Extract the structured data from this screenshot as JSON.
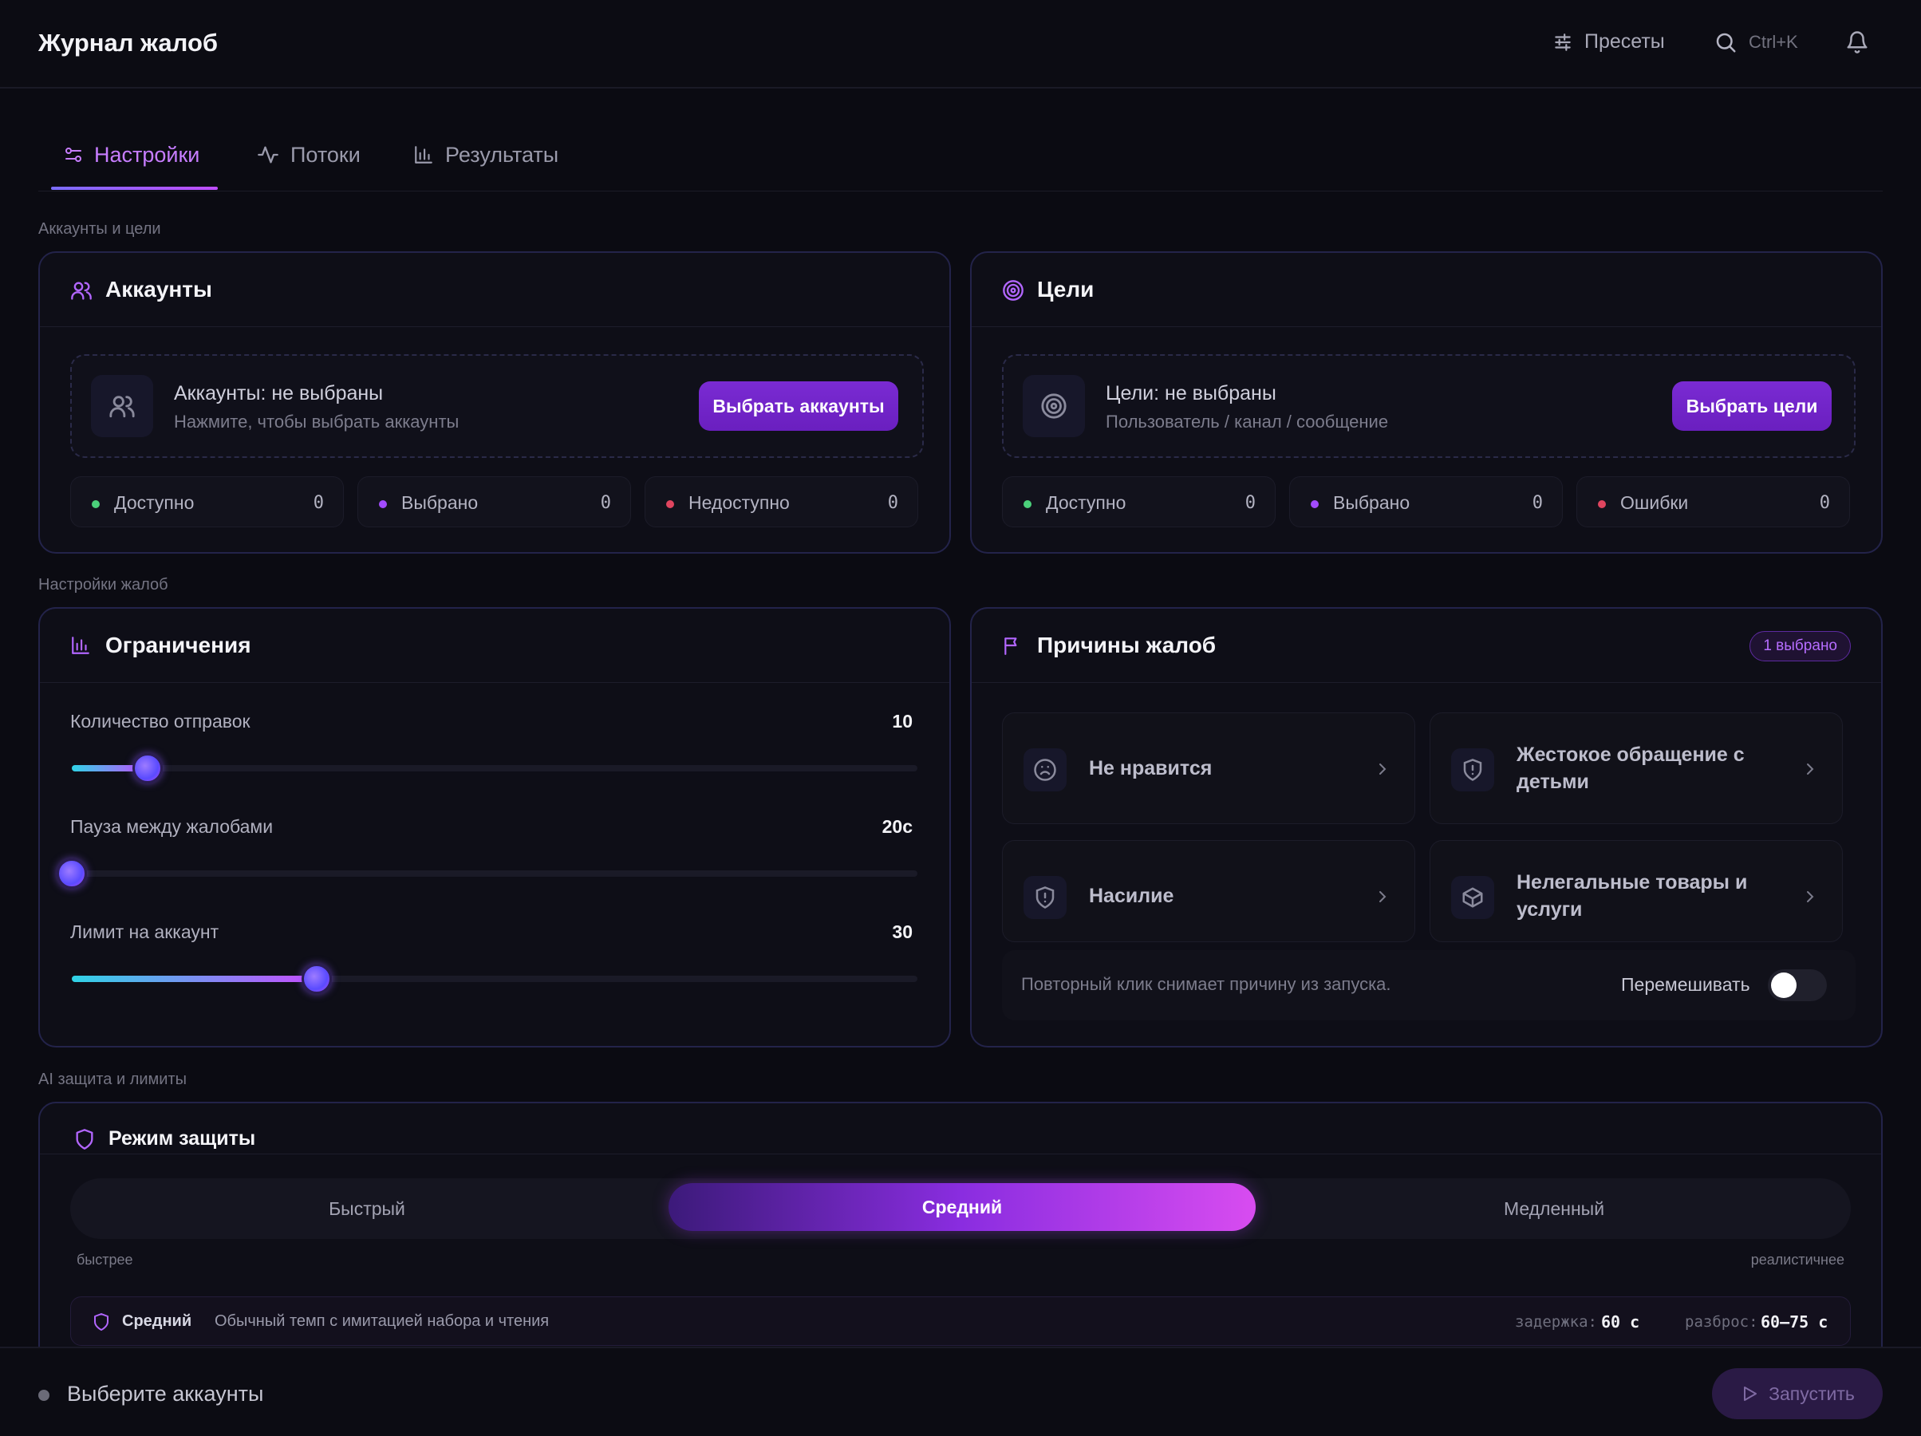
{
  "header": {
    "title": "Журнал жалоб",
    "presets_label": "Пресеты",
    "search_shortcut": "Ctrl+K"
  },
  "tabs": [
    {
      "label": "Настройки",
      "active": true,
      "icon": "sliders-icon"
    },
    {
      "label": "Потоки",
      "active": false,
      "icon": "activity-icon"
    },
    {
      "label": "Результаты",
      "active": false,
      "icon": "bar-chart-icon"
    }
  ],
  "sections": {
    "accounts_targets": "Аккаунты и цели",
    "complaint_settings": "Настройки жалоб",
    "ai_protection": "AI защита и лимиты"
  },
  "accounts": {
    "title": "Аккаунты",
    "status_title": "Аккаунты: не выбраны",
    "status_sub": "Нажмите, чтобы выбрать аккаунты",
    "button": "Выбрать аккаунты",
    "stats": [
      {
        "label": "Доступно",
        "value": "0",
        "color": "#4bd07a"
      },
      {
        "label": "Выбрано",
        "value": "0",
        "color": "#a24bff"
      },
      {
        "label": "Недоступно",
        "value": "0",
        "color": "#e0455f"
      }
    ]
  },
  "targets": {
    "title": "Цели",
    "status_title": "Цели: не выбраны",
    "status_sub": "Пользователь / канал / сообщение",
    "button": "Выбрать цели",
    "stats": [
      {
        "label": "Доступно",
        "value": "0",
        "color": "#4bd07a"
      },
      {
        "label": "Выбрано",
        "value": "0",
        "color": "#a24bff"
      },
      {
        "label": "Ошибки",
        "value": "0",
        "color": "#e0455f"
      }
    ]
  },
  "limits": {
    "title": "Ограничения",
    "sliders": [
      {
        "label": "Количество отправок",
        "value": "10",
        "fraction": 0.09
      },
      {
        "label": "Пауза между жалобами",
        "value": "20с",
        "fraction": 0.0
      },
      {
        "label": "Лимит на аккаунт",
        "value": "30",
        "fraction": 0.29
      }
    ]
  },
  "reasons": {
    "title": "Причины жалоб",
    "selected_badge": "1 выбрано",
    "items": [
      {
        "label": "Не нравится",
        "icon": "frown-icon"
      },
      {
        "label": "Жестокое обращение с детьми",
        "icon": "shield-alert-icon"
      },
      {
        "label": "Насилие",
        "icon": "shield-alert-icon"
      },
      {
        "label": "Нелегальные товары и услуги",
        "icon": "box-icon"
      }
    ],
    "footer_note": "Повторный клик снимает причину из запуска.",
    "shuffle_label": "Перемешивать",
    "shuffle_on": false
  },
  "protection": {
    "title": "Режим защиты",
    "modes": [
      "Быстрый",
      "Средний",
      "Медленный"
    ],
    "active_mode": "Средний",
    "hint_left": "быстрее",
    "hint_right": "реалистичнее",
    "info_name": "Средний",
    "info_desc": "Обычный темп с имитацией набора и чтения",
    "delay_label": "задержка:",
    "delay_value": "60 с",
    "spread_label": "разброс:",
    "spread_value": "60–75 с"
  },
  "footer": {
    "status": "Выберите аккаунты",
    "run_button": "Запустить"
  },
  "colors": {
    "accent": "#8a2de0",
    "accent_text": "#c77dff",
    "background": "#0b0b12"
  }
}
